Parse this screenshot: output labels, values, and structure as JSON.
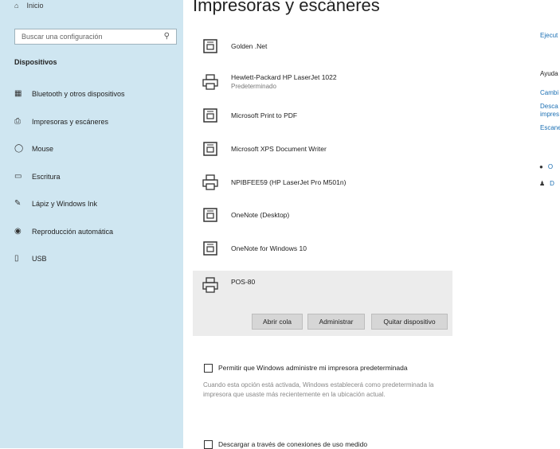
{
  "sidebar": {
    "home_label": "Inicio",
    "search_placeholder": "Buscar una configuración",
    "section_title": "Dispositivos",
    "items": [
      {
        "label": "Bluetooth y otros dispositivos",
        "icon": "bluetooth-icon"
      },
      {
        "label": "Impresoras y escáneres",
        "icon": "printer-icon"
      },
      {
        "label": "Mouse",
        "icon": "mouse-icon"
      },
      {
        "label": "Escritura",
        "icon": "keyboard-icon"
      },
      {
        "label": "Lápiz y Windows Ink",
        "icon": "pen-icon"
      },
      {
        "label": "Reproducción automática",
        "icon": "autoplay-icon"
      },
      {
        "label": "USB",
        "icon": "usb-icon"
      }
    ]
  },
  "main": {
    "title": "Impresoras y escáneres",
    "devices": [
      {
        "name": "Golden .Net",
        "sub": "",
        "icon": "document-printer-icon"
      },
      {
        "name": "Hewlett-Packard HP LaserJet 1022",
        "sub": "Predeterminado",
        "icon": "printer-icon"
      },
      {
        "name": "Microsoft Print to PDF",
        "sub": "",
        "icon": "document-printer-icon"
      },
      {
        "name": "Microsoft XPS Document Writer",
        "sub": "",
        "icon": "document-printer-icon"
      },
      {
        "name": "NPIBFEE59 (HP LaserJet Pro M501n)",
        "sub": "",
        "icon": "printer-icon"
      },
      {
        "name": "OneNote (Desktop)",
        "sub": "",
        "icon": "document-printer-icon"
      },
      {
        "name": "OneNote for Windows 10",
        "sub": "",
        "icon": "document-printer-icon"
      }
    ],
    "selected_device": {
      "name": "POS-80",
      "icon": "printer-icon"
    },
    "buttons": {
      "open_queue": "Abrir cola",
      "manage": "Administrar",
      "remove": "Quitar dispositivo"
    },
    "checkbox_default": {
      "label": "Permitir que Windows administre mi impresora predeterminada",
      "checked": false
    },
    "description": "Cuando esta opción está activada, Windows establecerá como predeterminada la impresora que usaste más recientemente en la ubicación actual.",
    "checkbox_metered": {
      "label": "Descargar a través de conexiones de uso medido",
      "checked": false
    }
  },
  "right": {
    "link1": "Ejecut",
    "help_title": "Ayuda",
    "link2": "Cambi",
    "link3a": "Desca",
    "link3b": "impres",
    "link4": "Escane",
    "link5": "O",
    "link6": "D"
  }
}
